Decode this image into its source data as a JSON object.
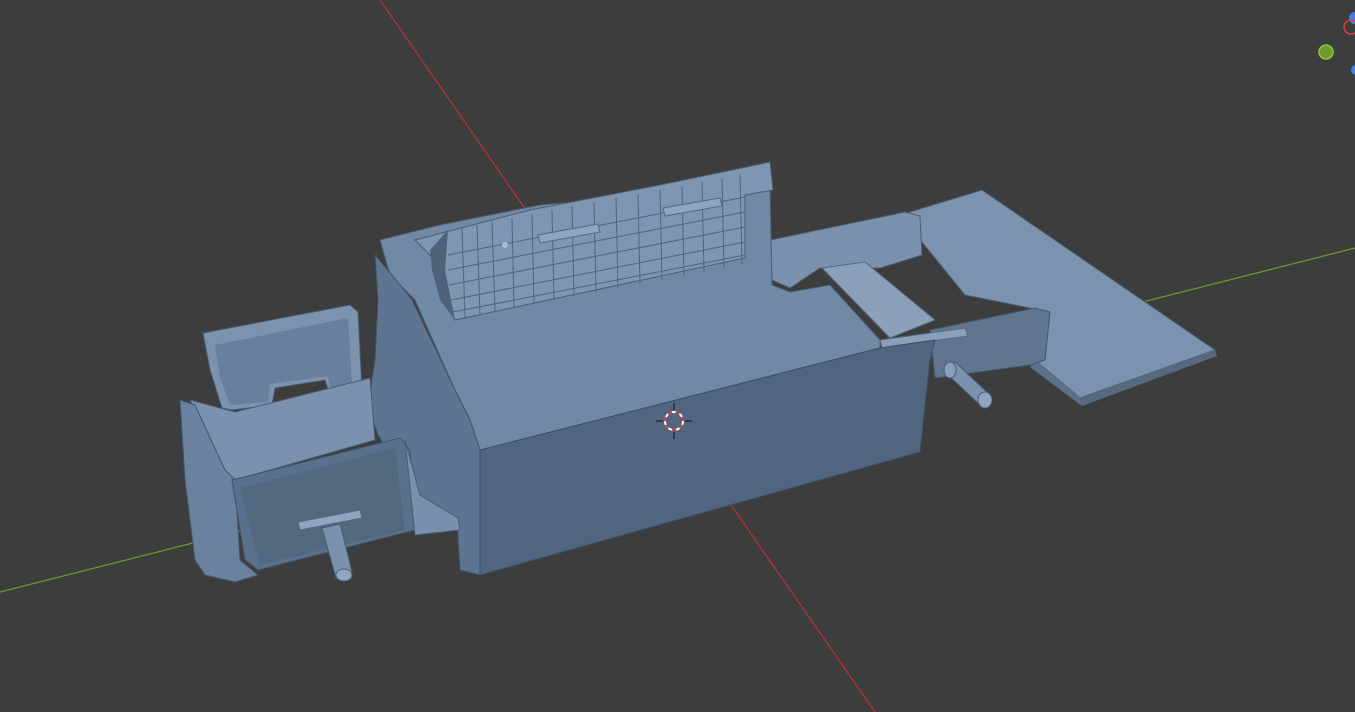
{
  "viewport": {
    "background": "#3d3d3d"
  },
  "axes": {
    "x_axis_color": "#b7353d",
    "y_axis_color": "#6c9a2b"
  },
  "model": {
    "base_color": "#6f88a3",
    "top_color": "#7d95b0",
    "side_color": "#566c86",
    "dark_side_color": "#4a5d73",
    "edge_color": "#3b4b5e"
  },
  "cursor": {
    "icon": "3d-cursor-icon",
    "ring_color_a": "#e23b3b",
    "ring_color_b": "#ffffff"
  },
  "navigation_gizmo": {
    "x_color": "#e23b3b",
    "y_color": "#8dc63f",
    "z_color": "#3f83e2"
  }
}
